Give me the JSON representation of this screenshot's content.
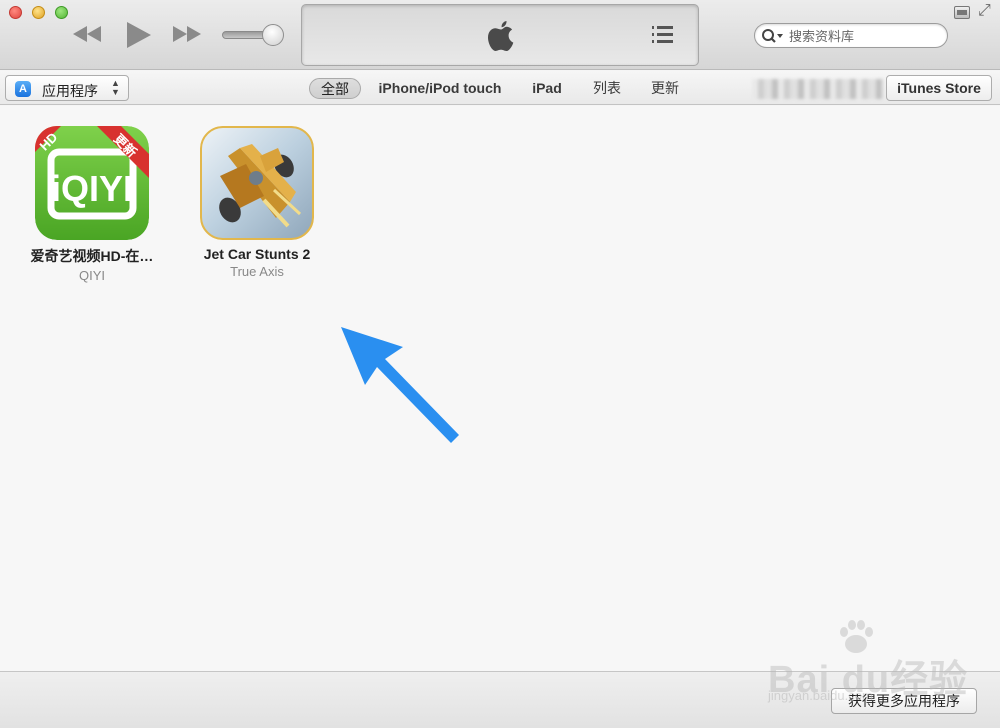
{
  "titlebar": {
    "search": {
      "placeholder": "搜索资料库"
    }
  },
  "icons": {
    "window_controls": [
      "close-icon",
      "minimize-icon",
      "zoom-icon"
    ],
    "transport": [
      "previous-track-icon",
      "play-icon",
      "next-track-icon"
    ],
    "lcd": [
      "apple-logo-icon",
      "up-next-icon"
    ],
    "window_right": [
      "miniplayer-icon",
      "fullscreen-icon"
    ]
  },
  "navbar": {
    "library_label": "应用程序",
    "tabs": [
      {
        "label": "全部",
        "selected": true
      },
      {
        "label": "iPhone/iPod touch",
        "selected": false
      },
      {
        "label": "iPad",
        "selected": false
      },
      {
        "label": "列表",
        "selected": false
      },
      {
        "label": "更新",
        "selected": false
      }
    ],
    "store_label": "iTunes Store"
  },
  "apps": [
    {
      "name": "爱奇艺视频HD-在…",
      "developer": "QIYI",
      "icon_text": "iQIYI",
      "badge_hd": "HD",
      "ribbon": "更新"
    },
    {
      "name": "Jet Car Stunts 2",
      "developer": "True Axis"
    }
  ],
  "footer": {
    "more_apps_label": "获得更多应用程序"
  },
  "watermark": {
    "main": "Bai  du经验",
    "sub": "jingyan.baidu.com"
  },
  "colors": {
    "iqiyi_green": "#5cb832",
    "ribbon_red": "#d8322f",
    "arrow_blue": "#2a8ff0",
    "selected_tab": "#d6d6d6"
  }
}
